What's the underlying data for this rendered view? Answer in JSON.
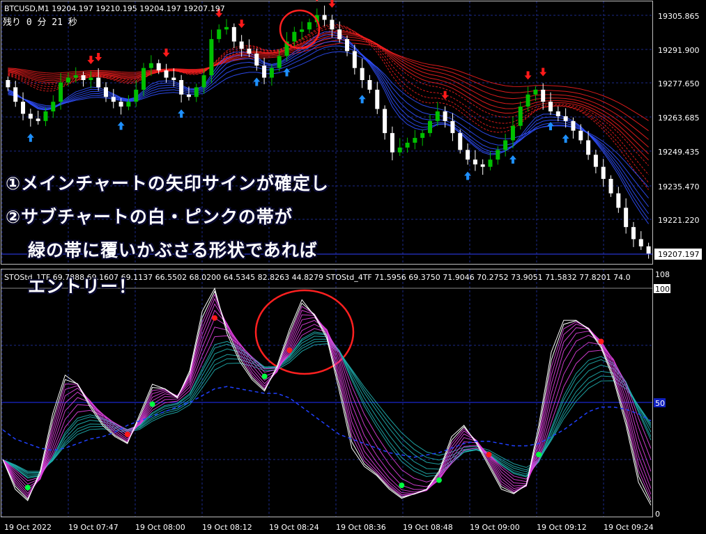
{
  "main_chart": {
    "symbol_header": "BTCUSD,M1  19204.197 19210.195 19204.197 19207.197",
    "countdown": "残り  0 分  21 秒",
    "price_labels": [
      "19305.865",
      "19291.900",
      "19277.650",
      "19263.685",
      "19249.435",
      "19235.470",
      "19221.220"
    ],
    "current_price": "19207.197",
    "colors": {
      "bull": "#00c000",
      "bear": "#ffffff",
      "up_arrow": "#1e90ff",
      "down_arrow": "#ff1a1a",
      "ribbon_red": "#ff2020",
      "ribbon_blue": "#3050ff",
      "grid": "#1c2a8a",
      "highlight": "#ff2020"
    }
  },
  "sub_chart": {
    "indicator_header": "STOStd_1TF 69.7888 69.1607 69.1137 66.5502 68.0200 64.5345 82.8263 44.8279   STOStd_4TF 71.5956 69.3750 71.9046 70.2752 73.9051 71.5832 77.8201 74.0",
    "level_108": "108",
    "level_100": "100",
    "level_50": "50",
    "level_0": "0",
    "colors": {
      "white_band": "#ffffff",
      "pink_band": "#e040e0",
      "teal_band": "#20b0b0",
      "slow_line": "#2040ff",
      "cross_up": "#00ff40",
      "cross_down": "#ff1a1a"
    }
  },
  "time_axis": [
    "19 Oct 2022",
    "19 Oct 07:47",
    "19 Oct 08:00",
    "19 Oct 08:12",
    "19 Oct 08:24",
    "19 Oct 08:36",
    "19 Oct 08:48",
    "19 Oct 09:00",
    "19 Oct 09:12",
    "19 Oct 09:24"
  ],
  "overlay_text": {
    "line1": "①メインチャートの矢印サインが確定し",
    "line2": "②サブチャートの白・ピンクの帯が",
    "line3": "緑の帯に覆いかぶさる形状であれば",
    "line4": "エントリー！"
  },
  "chart_data": [
    {
      "type": "candlestick",
      "title": "BTCUSD,M1",
      "y_ticks": [
        19305.865,
        19291.9,
        19277.65,
        19263.685,
        19249.435,
        19235.47,
        19221.22
      ],
      "ylim": [
        19203,
        19314
      ],
      "candles_close": [
        19276,
        19270,
        19265,
        19263,
        19262,
        19266,
        19270,
        19278,
        19280,
        19281,
        19279,
        19280,
        19276,
        19272,
        19270,
        19268,
        19270,
        19275,
        19284,
        19286,
        19283,
        19280,
        19279,
        19273,
        19272,
        19276,
        19281,
        19296,
        19300,
        19301,
        19295,
        19292,
        19290,
        19285,
        19280,
        19284,
        19289,
        19295,
        19299,
        19300,
        19303,
        19306,
        19304,
        19300,
        19296,
        19291,
        19284,
        19279,
        19275,
        19267,
        19257,
        19249,
        19251,
        19253,
        19255,
        19257,
        19262,
        19266,
        19262,
        19257,
        19250,
        19246,
        19244,
        19243,
        19246,
        19250,
        19254,
        19260,
        19268,
        19273,
        19275,
        19270,
        19266,
        19264,
        19262,
        19258,
        19254,
        19248,
        19243,
        19238,
        19232,
        19226,
        19218,
        19213,
        19210,
        19207
      ],
      "grid": true
    },
    {
      "type": "line",
      "title": "STOStd_1TF / STOStd_4TF",
      "ylim": [
        0,
        108
      ],
      "y_ticks": [
        0,
        50,
        100
      ],
      "series": [
        {
          "name": "STOStd_1TF",
          "values": [
            25,
            12,
            7,
            20,
            45,
            62,
            58,
            48,
            40,
            35,
            32,
            45,
            58,
            56,
            52,
            64,
            90,
            100,
            80,
            68,
            60,
            55,
            66,
            82,
            95,
            88,
            78,
            55,
            30,
            22,
            18,
            12,
            8,
            10,
            12,
            20,
            35,
            40,
            32,
            22,
            12,
            10,
            14,
            40,
            72,
            86,
            86,
            82,
            74,
            60,
            40,
            15,
            5
          ]
        },
        {
          "name": "STOStd_4TF",
          "values": [
            38,
            34,
            32,
            30,
            29,
            30,
            32,
            34,
            35,
            37,
            40,
            42,
            44,
            46,
            48,
            50,
            53,
            56,
            57,
            56,
            55,
            54,
            54,
            52,
            48,
            44,
            40,
            36,
            34,
            32,
            30,
            28,
            27,
            26,
            27,
            28,
            30,
            32,
            33,
            33,
            32,
            31,
            31,
            32,
            35,
            38,
            42,
            46,
            48,
            48,
            47,
            45,
            42
          ]
        }
      ],
      "grid": true
    }
  ]
}
